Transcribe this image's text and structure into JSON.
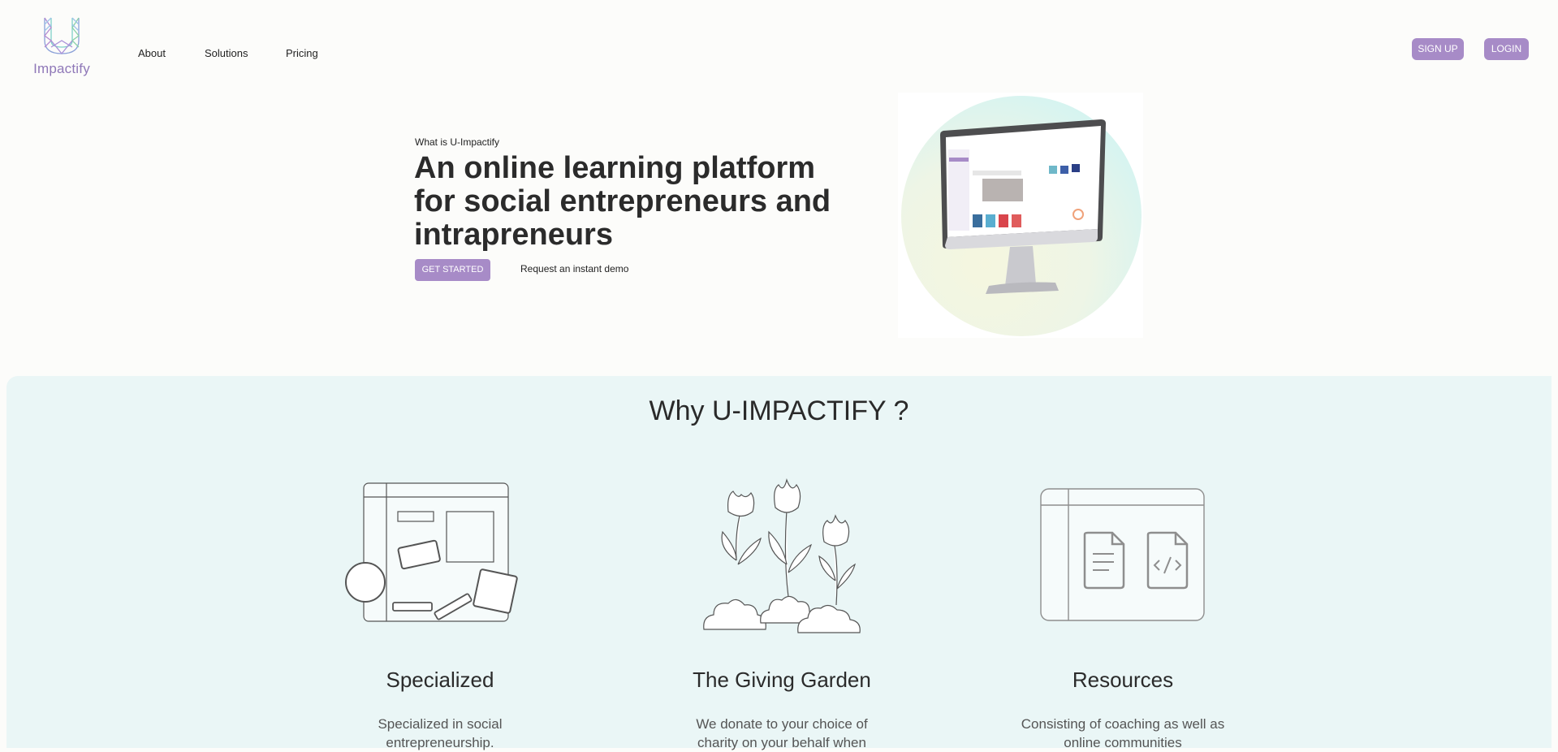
{
  "brand": {
    "logo_text": "Impactify"
  },
  "nav": {
    "items": [
      "About",
      "Solutions",
      "Pricing"
    ]
  },
  "auth": {
    "signup_label": "SIGN UP",
    "login_label": "LOGIN"
  },
  "hero": {
    "kicker": "What is U-Impactify",
    "title": "An online learning platform for social entrepreneurs and intrapreneurs",
    "cta_label": "GET STARTED",
    "demo_label": "Request an instant demo"
  },
  "why": {
    "title": "Why U-IMPACTIFY ?",
    "features": [
      {
        "title": "Specialized",
        "text": "Specialized in social entrepreneurship."
      },
      {
        "title": "The Giving Garden",
        "text": "We donate to your choice of charity on your behalf when"
      },
      {
        "title": "Resources",
        "text": "Consisting of coaching as well as online communities"
      }
    ]
  },
  "colors": {
    "accent": "#a78bc7",
    "section_bg": "#eaf6f6",
    "page_bg": "#fcfcfa"
  }
}
